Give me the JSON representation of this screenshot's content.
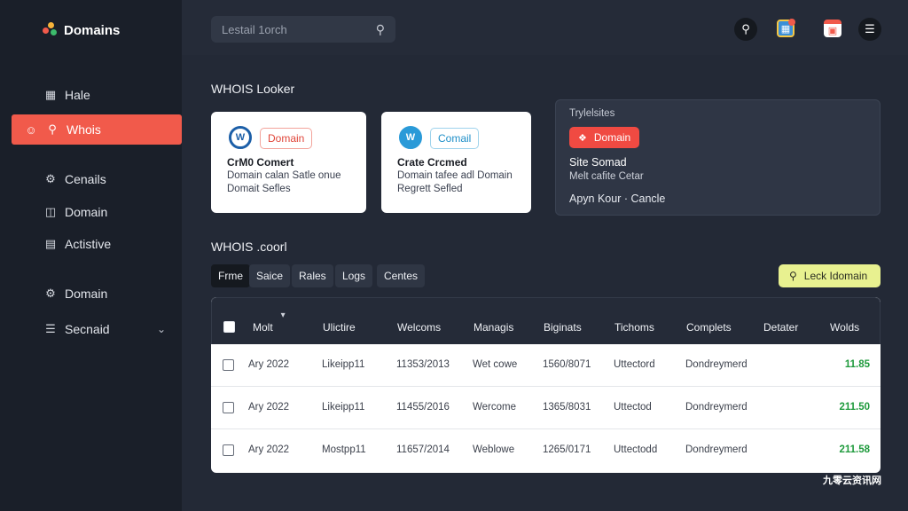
{
  "brand": {
    "name": "Domains"
  },
  "search": {
    "placeholder": "Lestail 1orch"
  },
  "sidebar": {
    "items": [
      {
        "label": "Hale",
        "icon": "home-icon",
        "active": false
      },
      {
        "label": "Whois",
        "icon": "search-icon",
        "active": true
      },
      {
        "label": "Cenails",
        "icon": "settings-icon",
        "active": false
      },
      {
        "label": "Domain",
        "icon": "building-icon",
        "active": false
      },
      {
        "label": "Actistive",
        "icon": "document-icon",
        "active": false
      },
      {
        "label": "Domain",
        "icon": "gear-icon",
        "active": false
      },
      {
        "label": "Secnaid",
        "icon": "list-icon",
        "active": false
      }
    ]
  },
  "main": {
    "title": "WHOIS Looker",
    "cards": [
      {
        "logo": "W",
        "pill": "Domain",
        "title": "CrM0 Comert",
        "line1": "Domain calan Satle onue",
        "line2": "Domait Sefles"
      },
      {
        "logo": "W",
        "pill": "Comail",
        "title": "Crate Crcmed",
        "line1": "Domain tafee adl Domain",
        "line2": "Regrett Sefled"
      }
    ],
    "dark_card": {
      "label": "Trylelsites",
      "button": "Domain",
      "title": "Site Somad",
      "subtitle": "Melt cafite Cetar",
      "link": "Apyn Kour · Cancle"
    },
    "table_title": "WHOIS .coorl",
    "tabs": [
      "Frme",
      "Saice",
      "Rales",
      "Logs",
      "Centes"
    ],
    "lookup_button": "Leck Idomain",
    "columns": [
      "Molt",
      "Ulictire",
      "Welcoms",
      "Managis",
      "Biginats",
      "Tichoms",
      "Complets",
      "Detater",
      "Wolds"
    ],
    "rows": [
      [
        "Ary 2022",
        "Likeipp11",
        "11353/2013",
        "Wet cowe",
        "1560/8071",
        "Uttectord",
        "Dondreymerd",
        "11.85"
      ],
      [
        "Ary 2022",
        "Likeipp11",
        "11455/2016",
        "Wercome",
        "1365/8031",
        "Uttectod",
        "Dondreymerd",
        "211.50"
      ],
      [
        "Ary 2022",
        "Mostpp11",
        "11657/2014",
        "Weblowe",
        "1265/0171",
        "Uttectodd",
        "Dondreymerd",
        "211.58"
      ]
    ]
  },
  "watermark": "九零云资讯网",
  "colors": {
    "accent": "#f15a4b",
    "lookup": "#e8f190",
    "value": "#1e9a3c"
  }
}
